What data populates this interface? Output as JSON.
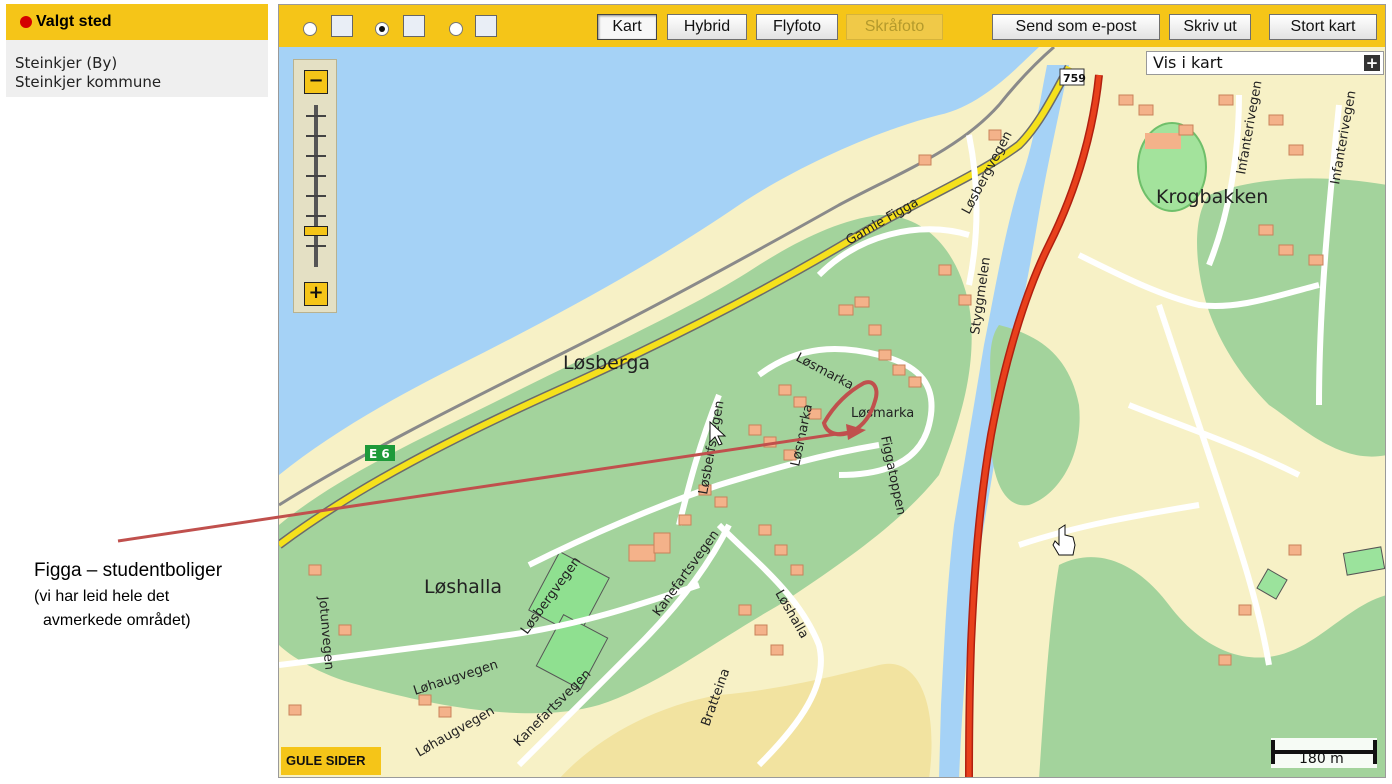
{
  "side_panel": {
    "header": "Valgt sted",
    "line1": "Steinkjer (By)",
    "line2": "Steinkjer kommune"
  },
  "annotation": {
    "title": "Figga – studentboliger",
    "line1": "(vi har leid hele det",
    "line2": "avmerkede området)"
  },
  "toolbar": {
    "kart": "Kart",
    "hybrid": "Hybrid",
    "flyfoto": "Flyfoto",
    "skrafoto": "Skråfoto",
    "email": "Send som e-post",
    "print": "Skriv ut",
    "big": "Stort kart"
  },
  "vis_i_kart": {
    "label": "Vis i kart",
    "plus": "+"
  },
  "zoom": {
    "minus": "−",
    "plus": "+"
  },
  "map_labels": {
    "losberga": "Løsberga",
    "loshalla": "Løshalla",
    "krogbakken": "Krogbakken",
    "gamle_figga": "Gamle Figga",
    "losbergvegen_top": "Løsbergvegen",
    "styggmelen": "Styggmelen",
    "losmarka1": "Løsmarka",
    "losmarka2": "Løsmarka",
    "losmarka3": "Løsmarka",
    "figgatoppen": "Figgatoppen",
    "losberfsvegen": "Løsberfsvegen",
    "losbergvegen_low": "Løsbergvegen",
    "kanefartsvegen1": "Kanefartsvegen",
    "kanefartsvegen2": "Kanefartsvegen",
    "loshalla_road": "Løshalla",
    "brattelina": "Bratteina",
    "johuvegen": "Jotunvegen",
    "lohaugvegen1": "Løhaugvegen",
    "lohaugvegen2": "Løhaugvegen",
    "infanterivegen1": "Infanterivegen",
    "infanterivegen2": "Infanterivegen",
    "e6": "E 6",
    "r759": "759"
  },
  "logo": "GULE SIDER",
  "scale": "180 m",
  "colors": {
    "accent": "#f5c518",
    "water": "#a5d2f6",
    "forest": "#a3d39c",
    "marker": "#c0504d",
    "road_main": "#e8401c"
  }
}
